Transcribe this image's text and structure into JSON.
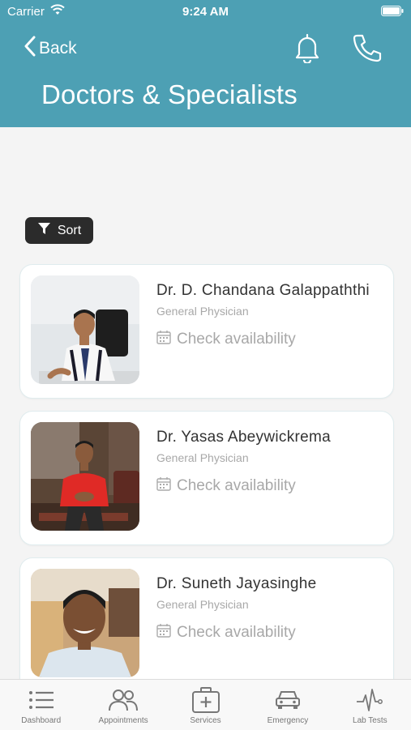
{
  "status_bar": {
    "carrier": "Carrier",
    "time": "9:24 AM"
  },
  "header": {
    "back_label": "Back",
    "title": "Doctors & Specialists"
  },
  "sort": {
    "label": "Sort"
  },
  "doctors": [
    {
      "name": "Dr. D. Chandana Galappaththi",
      "specialty": "General Physician",
      "action": "Check availability"
    },
    {
      "name": "Dr. Yasas Abeywickrema",
      "specialty": "General Physician",
      "action": "Check availability"
    },
    {
      "name": "Dr. Suneth Jayasinghe",
      "specialty": "General Physician",
      "action": "Check availability"
    }
  ],
  "tabs": [
    {
      "label": "Dashboard",
      "icon": "list-icon"
    },
    {
      "label": "Appointments",
      "icon": "people-icon"
    },
    {
      "label": "Services",
      "icon": "medical-kit-icon"
    },
    {
      "label": "Emergency",
      "icon": "car-icon"
    },
    {
      "label": "Lab Tests",
      "icon": "pulse-icon"
    }
  ],
  "colors": {
    "header": "#4da0b4",
    "sort_button": "#2b2b2b",
    "background": "#f4f4f4"
  }
}
